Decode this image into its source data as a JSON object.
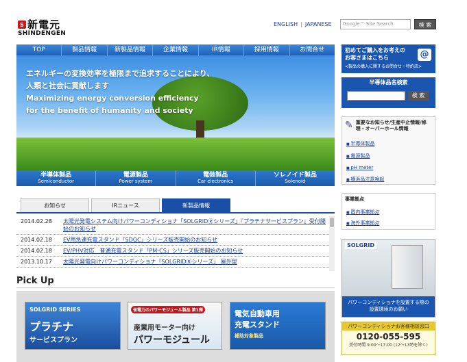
{
  "header": {
    "logo_mark": "S",
    "logo_jp": "新電元",
    "logo_en": "SHINDENGEN",
    "lang_english": "ENGLISH",
    "lang_japanese": "JAPANESE",
    "lang_sep": "|",
    "search_placeholder": "Google™ Site Search",
    "search_button": "検 索"
  },
  "nav": {
    "items": [
      "TOP",
      "製品情報",
      "新製品情報",
      "企業情報",
      "IR情報",
      "採用情報",
      "お問合せ"
    ]
  },
  "hero": {
    "line1": "エネルギーの変換効率を極限まで追求することにより、",
    "line2": "人類と社会に貢献します",
    "line3": "Maximizing energy conversion efficiency",
    "line4": "for the benefit of humanity and society"
  },
  "products": [
    {
      "jp": "半導体製品",
      "en": "Semiconductor"
    },
    {
      "jp": "電源製品",
      "en": "Power system"
    },
    {
      "jp": "電装製品",
      "en": "Car electronics"
    },
    {
      "jp": "ソレノイド製品",
      "en": "Solenoid"
    }
  ],
  "tabs": {
    "items": [
      "お知らせ",
      "IRニュース",
      "新製品情報"
    ],
    "active_index": 2
  },
  "news": [
    {
      "date": "2014.02.28",
      "text": "太陽光発電システム向けパワーコンディショナ「SOLGRIDⓇシリーズ」『プラチナサービスプラン』受付開始のお知らせ"
    },
    {
      "date": "2014.02.18",
      "text": "EV用急速充電スタンド「SDQC」シリーズ販売開始のお知らせ"
    },
    {
      "date": "2014.02.18",
      "text": "EV/PHV対応　普通充電スタンド「PM-CS」シリーズ販売開始のお知らせ"
    },
    {
      "date": "2013.10.17",
      "text": "太陽光発電向けパワーコンディショナ「SOLGRIDⓇシリーズ」 屋外型"
    }
  ],
  "pickup": {
    "title": "Pick Up",
    "cards": [
      {
        "l1": "SOLGRID SERIES",
        "l2": "プラチナ",
        "l3": "サービスプラン"
      },
      {
        "l1": "省電力のパワーモジュール製品 第1弾",
        "l2": "産業用モーター向け",
        "l3": "パワーモジュール"
      },
      {
        "l1": "電気自動車用",
        "l2": "充電スタンド",
        "l3": "補助対象製品"
      }
    ]
  },
  "sidebar": {
    "banner_l1": "初めてご購入をお考えの",
    "banner_l2": "お客さまはこちら",
    "banner_l3": "<製品の購入に関するお問合せ・特約店>",
    "mail_icon": "@",
    "semi_title": "半導体品名検索",
    "semi_button": "検 索",
    "notice_title": "重要なお知らせ/生産中止情報/修理・オーバーホール情報",
    "notice_links": [
      "半導体製品",
      "電源製品",
      "pH meter",
      "横浜品注意喚起"
    ],
    "biz_title": "事業拠点",
    "biz_links": [
      "国内事業拠点",
      "海外事業拠点"
    ],
    "solgrid_logo": "SOLGRID",
    "solgrid_cap_l1": "パワーコンディショナを設置する際の",
    "solgrid_cap_l2": "設置環境のお願い",
    "contact_title": "パワーコンディショナお客様相談窓口",
    "contact_phone": "0120-055-595",
    "contact_hours": "受付時間 9:00〜17:00 (12〜13時を除く)"
  }
}
